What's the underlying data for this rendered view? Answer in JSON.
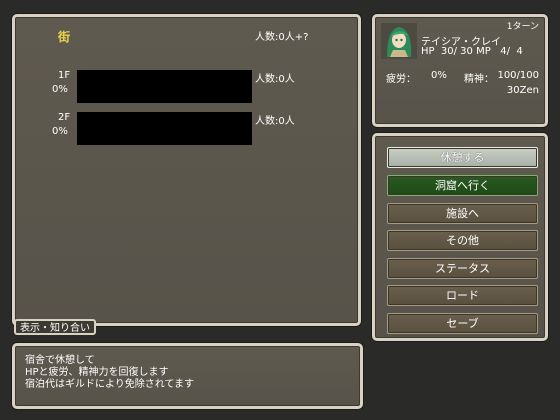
{
  "main": {
    "town_title": "街",
    "population_total": "人数:0人+?",
    "floors": [
      {
        "label": "1F",
        "percent": "0%",
        "population": "人数:0人"
      },
      {
        "label": "2F",
        "percent": "0%",
        "population": "人数:0人"
      }
    ],
    "tab_label": "表示・知り合い"
  },
  "status": {
    "turn": "1ターン",
    "name": "テイシア・クレイ",
    "hp_line": "HP  30/ 30 MP   4/  4",
    "fatigue_label": "疲労：",
    "fatigue_value": "0%",
    "spirit_label": "精神：",
    "spirit_value": "100/100",
    "money": "30Zen"
  },
  "menu": {
    "items": [
      {
        "label": "休憩する"
      },
      {
        "label": "洞窟へ行く"
      },
      {
        "label": "施設へ"
      },
      {
        "label": "その他"
      },
      {
        "label": "ステータス"
      },
      {
        "label": "ロード"
      },
      {
        "label": "セーブ"
      }
    ]
  },
  "message": {
    "lines": [
      "宿舎で休憩して",
      "HPと疲労、精神力を回復します",
      "宿泊代はギルドにより免除されてます"
    ]
  }
}
